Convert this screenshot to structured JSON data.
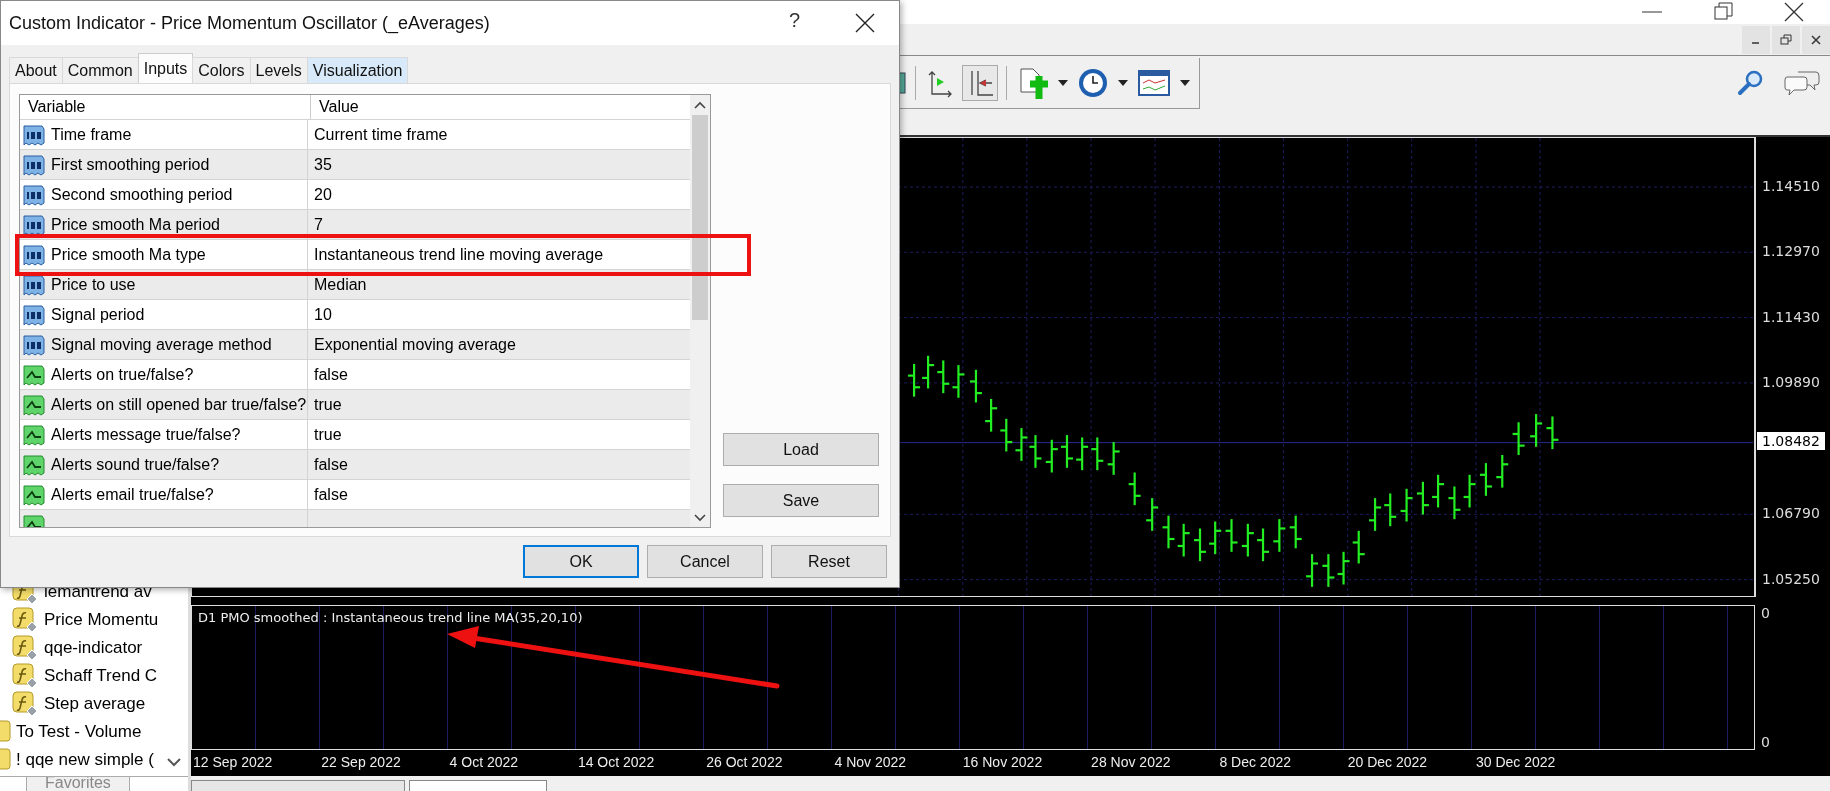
{
  "app": {
    "navigator": {
      "items": [
        {
          "kind": "indicator",
          "label": "lemantrend av"
        },
        {
          "kind": "indicator",
          "label": "Price Momentu"
        },
        {
          "kind": "indicator",
          "label": "qqe-indicator"
        },
        {
          "kind": "indicator",
          "label": "Schaff Trend C"
        },
        {
          "kind": "indicator",
          "label": "Step average"
        },
        {
          "kind": "folder",
          "label": "To Test - Volume"
        },
        {
          "kind": "folder",
          "label": "! qqe new simple ("
        }
      ],
      "tabs": [
        {
          "label": "Favorites"
        }
      ]
    },
    "chart": {
      "price_labels": [
        "1.14510",
        "1.12970",
        "1.11430",
        "1.09890",
        "1.06790",
        "1.05250"
      ],
      "current_price": "1.08482",
      "indicator": {
        "label": "D1 PMO smoothed : Instantaneous trend line MA(35,20,10)",
        "axis_labels": [
          "0",
          "0"
        ]
      },
      "date_labels": [
        "12 Sep 2022",
        "22 Sep 2022",
        "4 Oct 2022",
        "14 Oct 2022",
        "26 Oct 2022",
        "4 Nov 2022",
        "16 Nov 2022",
        "28 Nov 2022",
        "8 Dec 2022",
        "20 Dec 2022",
        "30 Dec 2022"
      ]
    }
  },
  "dialog": {
    "title": "Custom Indicator - Price Momentum Oscillator (_eAverages)",
    "help": "?",
    "tabs": [
      {
        "label": "About",
        "selected": false,
        "hovered": false
      },
      {
        "label": "Common",
        "selected": false,
        "hovered": false
      },
      {
        "label": "Inputs",
        "selected": true,
        "hovered": false
      },
      {
        "label": "Colors",
        "selected": false,
        "hovered": false
      },
      {
        "label": "Levels",
        "selected": false,
        "hovered": false
      },
      {
        "label": "Visualization",
        "selected": false,
        "hovered": true
      }
    ],
    "table": {
      "columns": [
        "Variable",
        "Value"
      ],
      "rows": [
        {
          "kind": "number",
          "variable": "Time frame",
          "value": "Current time frame"
        },
        {
          "kind": "number",
          "variable": "First smoothing period",
          "value": "35"
        },
        {
          "kind": "number",
          "variable": "Second smoothing period",
          "value": "20"
        },
        {
          "kind": "number",
          "variable": "Price smooth Ma period",
          "value": "7"
        },
        {
          "kind": "number",
          "variable": "Price smooth Ma type",
          "value": "Instantaneous trend line moving average"
        },
        {
          "kind": "number",
          "variable": "Price to use",
          "value": "Median"
        },
        {
          "kind": "number",
          "variable": "Signal period",
          "value": "10"
        },
        {
          "kind": "number",
          "variable": "Signal moving average method",
          "value": "Exponential moving average"
        },
        {
          "kind": "bool",
          "variable": "Alerts on true/false?",
          "value": "false"
        },
        {
          "kind": "bool",
          "variable": "Alerts on still opened bar true/false?",
          "value": "true"
        },
        {
          "kind": "bool",
          "variable": "Alerts message true/false?",
          "value": "true"
        },
        {
          "kind": "bool",
          "variable": "Alerts sound true/false?",
          "value": "false"
        },
        {
          "kind": "bool",
          "variable": "Alerts email true/false?",
          "value": "false"
        }
      ]
    },
    "side_buttons": [
      "Load",
      "Save"
    ],
    "buttons": [
      {
        "label": "OK",
        "default": true
      },
      {
        "label": "Cancel",
        "default": false
      },
      {
        "label": "Reset",
        "default": false
      }
    ]
  }
}
